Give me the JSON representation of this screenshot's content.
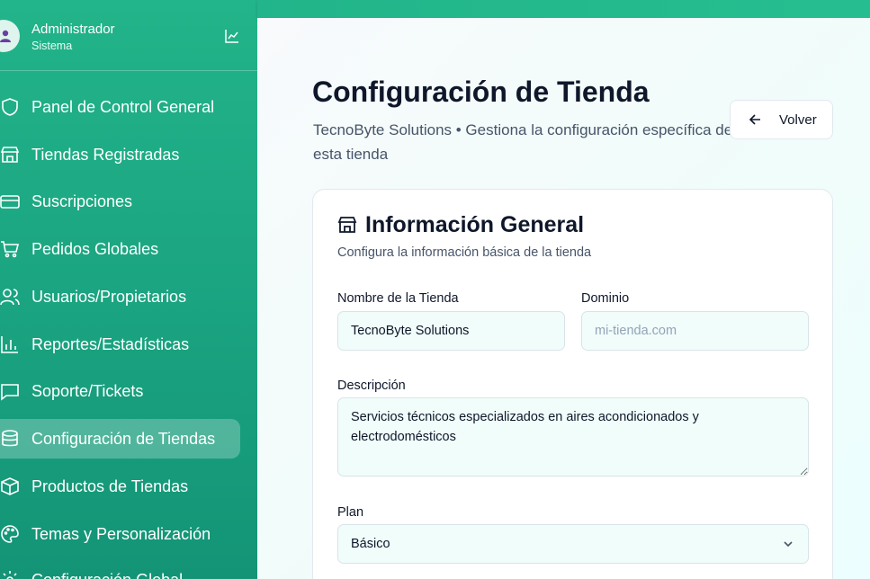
{
  "user": {
    "name": "Administrador",
    "role": "Sistema"
  },
  "sidebar": {
    "items": [
      {
        "label": "Panel de Control General",
        "icon": "shield-icon"
      },
      {
        "label": "Tiendas Registradas",
        "icon": "store-icon"
      },
      {
        "label": "Suscripciones",
        "icon": "credit-card-icon"
      },
      {
        "label": "Pedidos Globales",
        "icon": "cart-icon"
      },
      {
        "label": "Usuarios/Propietarios",
        "icon": "users-icon"
      },
      {
        "label": "Reportes/Estadísticas",
        "icon": "bar-chart-icon"
      },
      {
        "label": "Soporte/Tickets",
        "icon": "message-icon"
      },
      {
        "label": "Configuración de Tiendas",
        "icon": "database-icon",
        "active": true
      },
      {
        "label": "Productos de Tiendas",
        "icon": "package-icon"
      },
      {
        "label": "Temas y Personalización",
        "icon": "palette-icon"
      },
      {
        "label": "Configuración Global",
        "icon": "gear-icon"
      }
    ]
  },
  "header": {
    "title": "Configuración de Tienda",
    "subtitle": "TecnoByte Solutions • Gestiona la configuración específica de esta tienda",
    "back_label": "Volver"
  },
  "card": {
    "title": "Información General",
    "subtitle": "Configura la información básica de la tienda",
    "store_name_label": "Nombre de la Tienda",
    "store_name_value": "TecnoByte Solutions",
    "domain_label": "Dominio",
    "domain_placeholder": "mi-tienda.com",
    "description_label": "Descripción",
    "description_value": "Servicios técnicos especializados en aires acondicionados y electrodomésticos",
    "plan_label": "Plan",
    "plan_value": "Básico"
  },
  "colors": {
    "accent": "#1aa380",
    "active_bg": "rgba(255,255,255,0.25)"
  }
}
